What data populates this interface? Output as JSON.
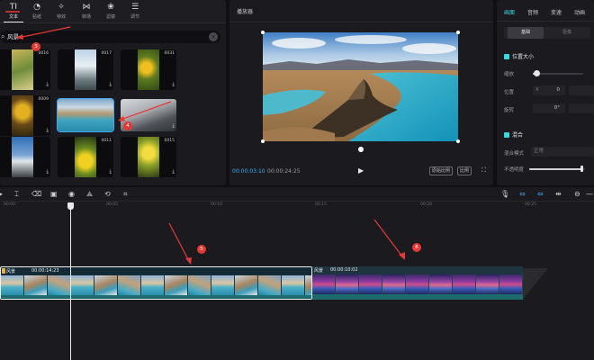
{
  "top_tabs": [
    {
      "label": "文本",
      "icon": "text-icon",
      "glyph": "TI",
      "active": true
    },
    {
      "label": "贴纸",
      "icon": "sticker-icon",
      "glyph": "◔"
    },
    {
      "label": "特效",
      "icon": "effects-icon",
      "glyph": "✧"
    },
    {
      "label": "转场",
      "icon": "transition-icon",
      "glyph": "⋈"
    },
    {
      "label": "滤镜",
      "icon": "filter-icon",
      "glyph": "❀"
    },
    {
      "label": "调节",
      "icon": "adjust-icon",
      "glyph": "☰"
    }
  ],
  "search": {
    "value": "风景",
    "clear": "×"
  },
  "media": {
    "durations": [
      "0016",
      "0017",
      "0031",
      "0009",
      "",
      "",
      "",
      "0011",
      "0015"
    ],
    "download_glyph": "⤓"
  },
  "player": {
    "title": "播放器",
    "current_time": "00:00:03:10",
    "total_time": "00:00:24:25",
    "play_glyph": "▶",
    "btn_original": "原始比例",
    "btn_ratio": "比例",
    "fullscreen_glyph": "⛶"
  },
  "props": {
    "tabs": [
      "画面",
      "音频",
      "变速",
      "动画"
    ],
    "subtabs": [
      "基础",
      "抠像"
    ],
    "section_position": "位置大小",
    "scale_label": "缩放",
    "position_label": "位置",
    "pos_x_prefix": "X",
    "pos_x_value": "0",
    "rotation_label": "旋转",
    "rotation_value": "0°",
    "section_blend": "混合",
    "blend_mode_label": "混合模式",
    "blend_mode_value": "正常",
    "opacity_label": "不透明度",
    "scale_level": 0.08,
    "opacity_level": 0.97
  },
  "timeline": {
    "ruler": [
      "00:00",
      "00:05",
      "00:10",
      "00:15",
      "00:20",
      "00:25"
    ],
    "clip1": {
      "name": "风景",
      "duration": "00:00:14:23"
    },
    "clip2": {
      "name": "风景",
      "duration": "00:00:10:02"
    }
  },
  "annotations": [
    "3",
    "4",
    "5",
    "6"
  ]
}
